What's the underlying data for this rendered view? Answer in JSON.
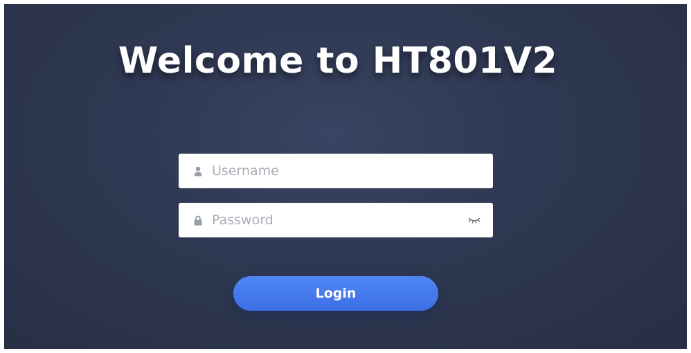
{
  "page": {
    "title": "Welcome to HT801V2"
  },
  "login_form": {
    "username": {
      "placeholder": "Username",
      "value": "",
      "icon": "user-icon"
    },
    "password": {
      "placeholder": "Password",
      "value": "",
      "icon": "lock-icon",
      "toggle_icon": "eye-closed-icon"
    },
    "login_label": "Login"
  },
  "colors": {
    "background": "#2f3953",
    "button": "#4a80ef",
    "text": "#ffffff",
    "placeholder": "#a9adb6"
  }
}
